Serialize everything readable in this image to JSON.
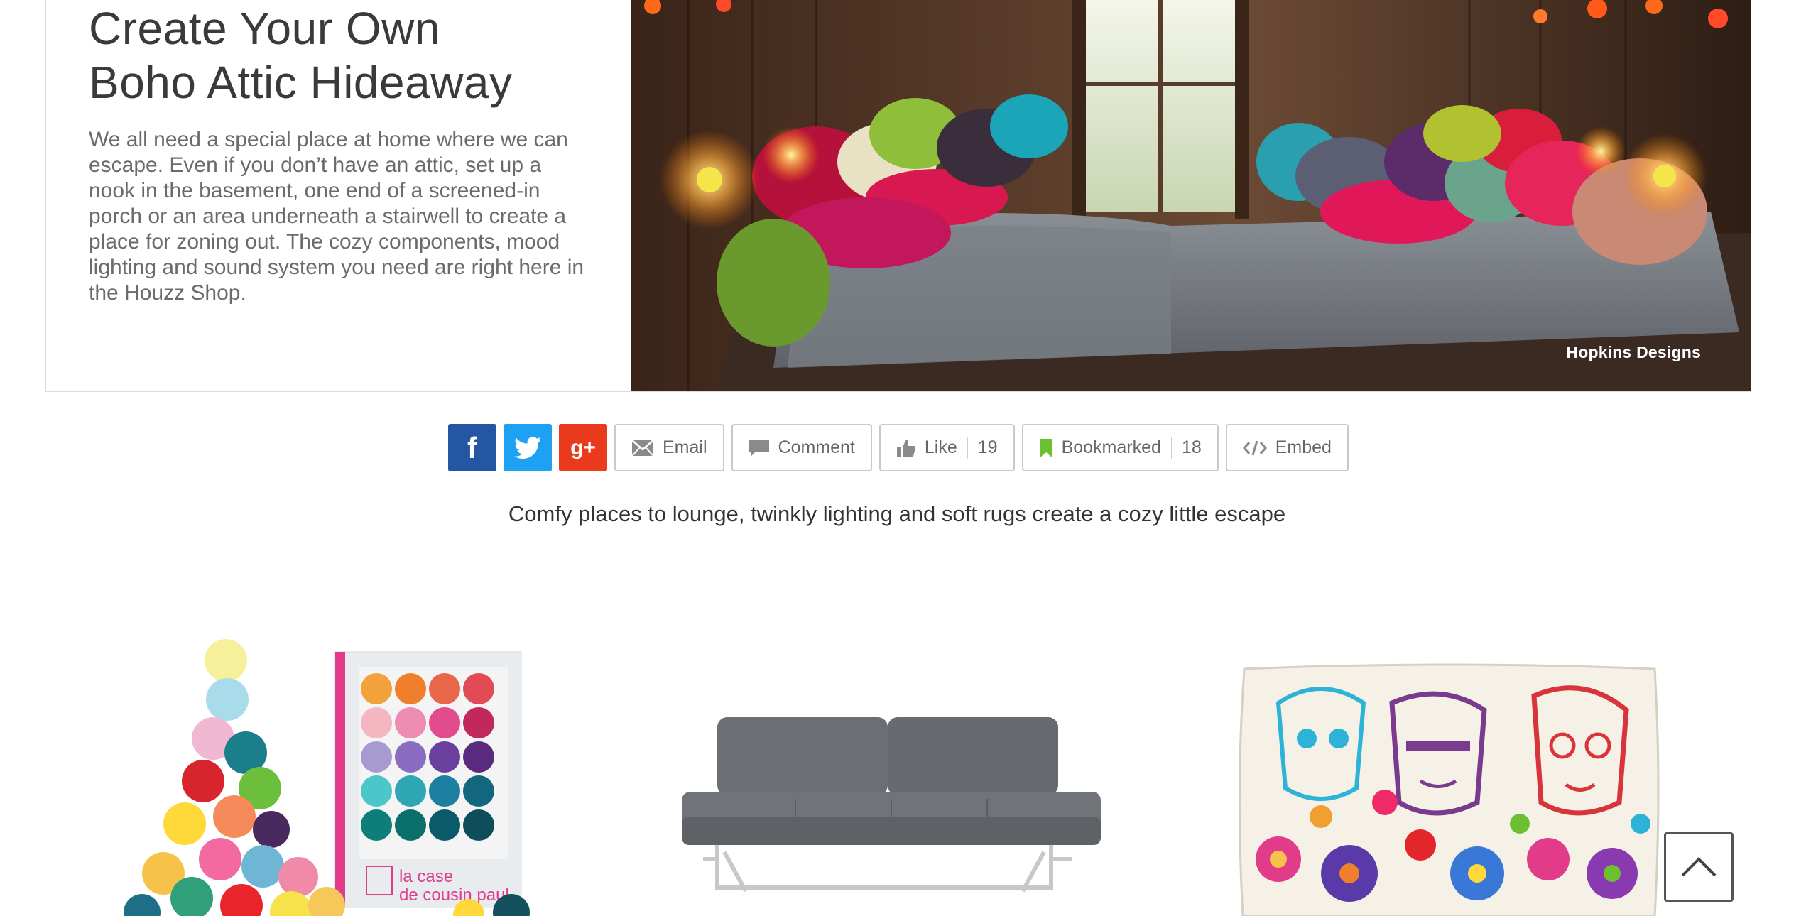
{
  "article": {
    "title_line1": "Create Your Own",
    "title_line2": "Boho Attic Hideaway",
    "body": "We all need a special place at home where we can escape. Even if you don’t have an attic, set up a nook in the basement, one end of a screened-in porch or an area underneath a stairwell to create a place for zoning out. The cozy components, mood lighting and sound system you need are right here in the Houzz Shop.",
    "photo_credit": "Hopkins Designs"
  },
  "share": {
    "facebook_icon": "f",
    "twitter_icon": "twitter-bird-icon",
    "googleplus_icon": "g+",
    "email_label": "Email",
    "comment_label": "Comment",
    "like_label": "Like",
    "like_count": "19",
    "bookmark_label": "Bookmarked",
    "bookmark_count": "18",
    "embed_label": "Embed",
    "colors": {
      "facebook": "#2456a4",
      "twitter": "#1da1f2",
      "googleplus": "#ea3a1e",
      "bookmark": "#6cbf2f"
    }
  },
  "caption": "Comfy places to lounge, twinkly lighting and soft rugs create a cozy little escape",
  "products": {
    "lights_box_text_line1": "la case",
    "lights_box_text_line2": "de cousin paul"
  }
}
